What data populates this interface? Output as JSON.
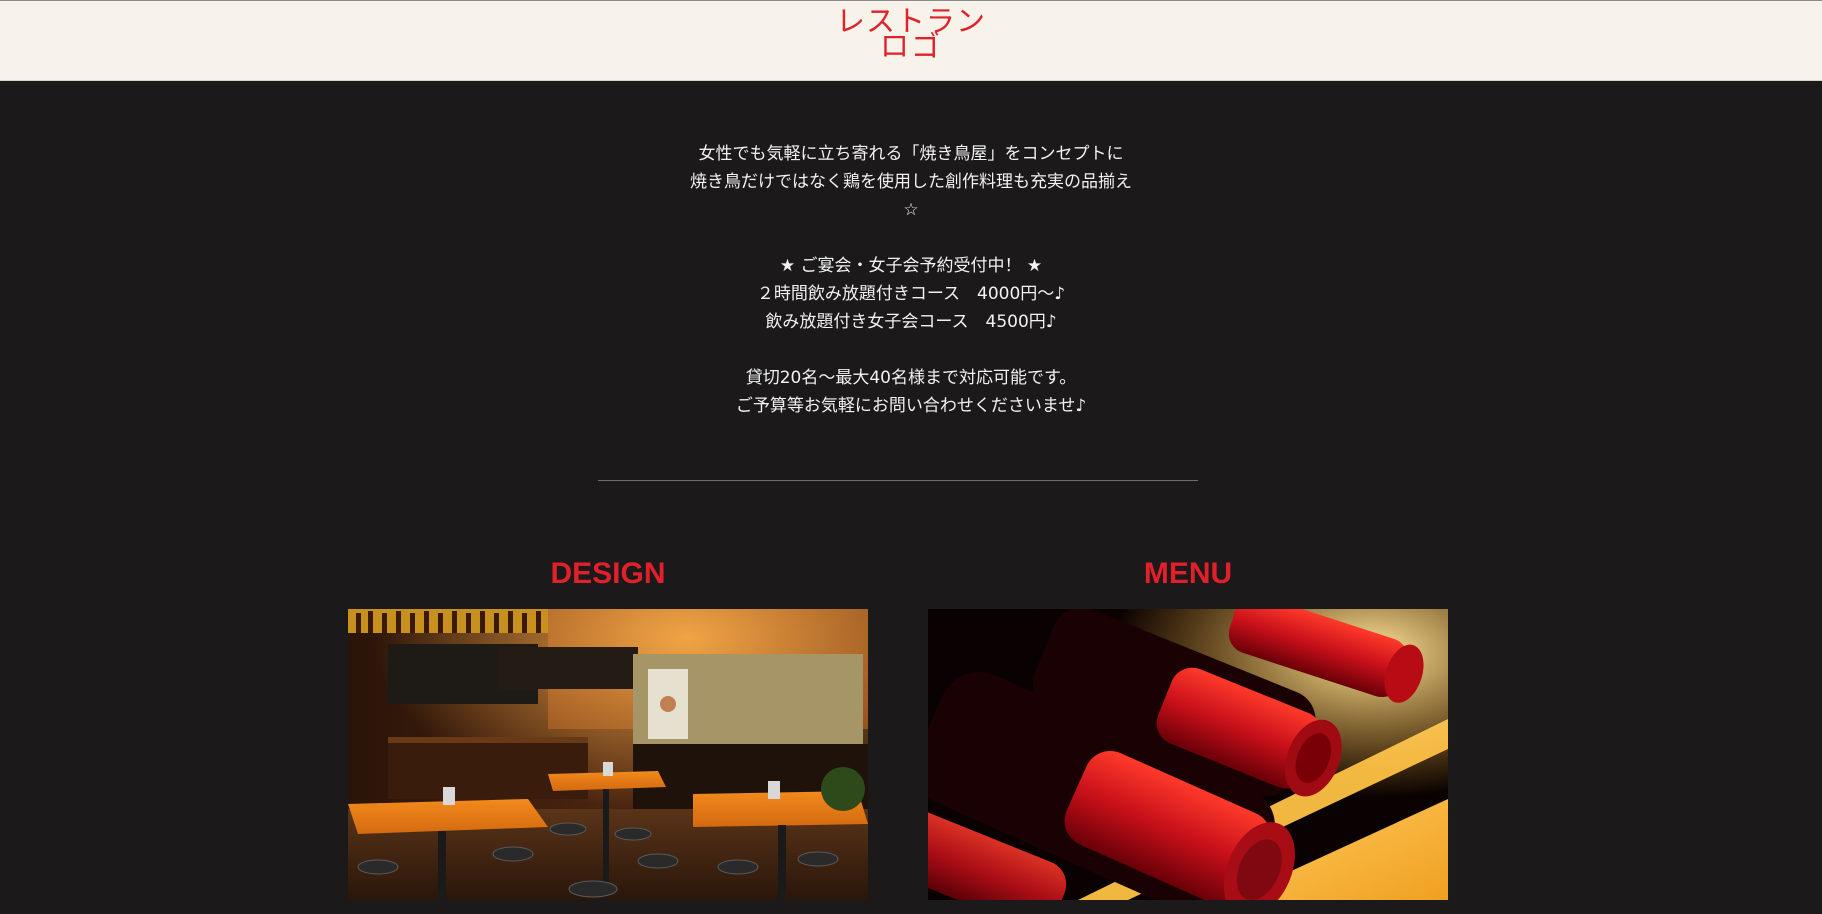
{
  "header": {
    "logo_line1": "レストラン",
    "logo_line2": "ロゴ",
    "accent_color": "#e0202a",
    "background_color": "#f7f3ea"
  },
  "intro": {
    "lines": [
      "女性でも気軽に立ち寄れる「焼き鳥屋」をコンセプトに",
      "焼き鳥だけではなく鶏を使用した創作料理も充実の品揃え",
      "☆",
      "",
      "★ ご宴会・女子会予約受付中！ ★",
      "２時間飲み放題付きコース　4000円〜♪",
      "飲み放題付き女子会コース　4500円♪",
      "",
      "貸切20名〜最大40名様まで対応可能です。",
      "ご予算等お気軽にお問い合わせくださいませ♪"
    ]
  },
  "sections": [
    {
      "title": "DESIGN",
      "image": "restaurant-interior-photo"
    },
    {
      "title": "MENU",
      "image": "wine-bottles-photo"
    }
  ]
}
